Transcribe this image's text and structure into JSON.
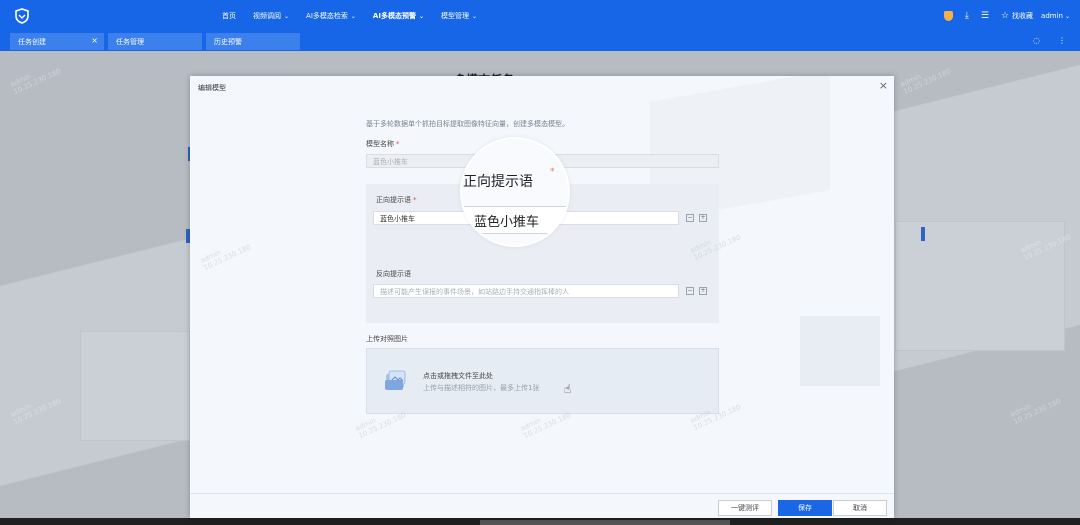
{
  "topnav": {
    "items": [
      {
        "label": "首页",
        "dropdown": false
      },
      {
        "label": "视频调阅",
        "dropdown": true
      },
      {
        "label": "AI多模态检索",
        "dropdown": true
      },
      {
        "label": "AI多模态预警",
        "dropdown": true,
        "active": true
      },
      {
        "label": "模型管理",
        "dropdown": true
      }
    ],
    "favorites_label": "找收藏",
    "user_label": "admin",
    "icons": [
      "logo-shield",
      "warning-shield-icon",
      "download-icon",
      "menu-icon",
      "star-icon"
    ]
  },
  "tabs": [
    {
      "label": "任务创建",
      "closable": true
    },
    {
      "label": "任务管理",
      "closable": false
    },
    {
      "label": "历史预警",
      "closable": false
    }
  ],
  "page": {
    "title_partial": "多模态任务"
  },
  "modal": {
    "title": "编辑模型",
    "description": "基于多轮数据单个抓拍目标提取图像特征向量，创建多模态模型。",
    "model_name_label": "模型名称",
    "model_name_value": "蓝色小推车",
    "positive_label": "正向提示语",
    "positive_value": "蓝色小推车",
    "negative_label": "反向提示语",
    "negative_placeholder": "描述可能产生误报的事件场景，如站路边手持交通指挥棒的人",
    "upload_section_label": "上传对照图片",
    "upload_main": "点击或拖拽文件至此处",
    "upload_sub": "上传与描述相符的图片，最多上传1张",
    "lens_label": "正向提示语",
    "lens_value": "蓝色小推车",
    "buttons": {
      "test": "一键测评",
      "save": "保存",
      "cancel": "取消"
    }
  },
  "watermark": {
    "user": "admin",
    "ip": "10.25.230.180"
  },
  "colors": {
    "brand": "#1766e8",
    "primary_button": "#1b66e5",
    "required": "#e04848"
  }
}
